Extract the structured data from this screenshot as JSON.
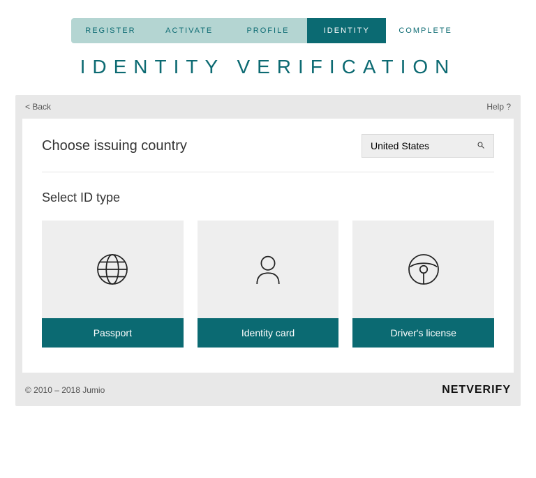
{
  "stepper": {
    "items": [
      {
        "label": "REGISTER",
        "state": "done"
      },
      {
        "label": "ACTIVATE",
        "state": "done"
      },
      {
        "label": "PROFILE",
        "state": "done"
      },
      {
        "label": "IDENTITY",
        "state": "active"
      },
      {
        "label": "COMPLETE",
        "state": "pending"
      }
    ]
  },
  "title": "IDENTITY VERIFICATION",
  "panel": {
    "back": "< Back",
    "help": "Help ?",
    "choose_country_label": "Choose issuing country",
    "country_value": "United States",
    "select_id_label": "Select ID type",
    "cards": [
      {
        "label": "Passport"
      },
      {
        "label": "Identity card"
      },
      {
        "label": "Driver's license"
      }
    ],
    "copyright": "© 2010 – 2018 Jumio",
    "brand": "NETVERIFY"
  }
}
